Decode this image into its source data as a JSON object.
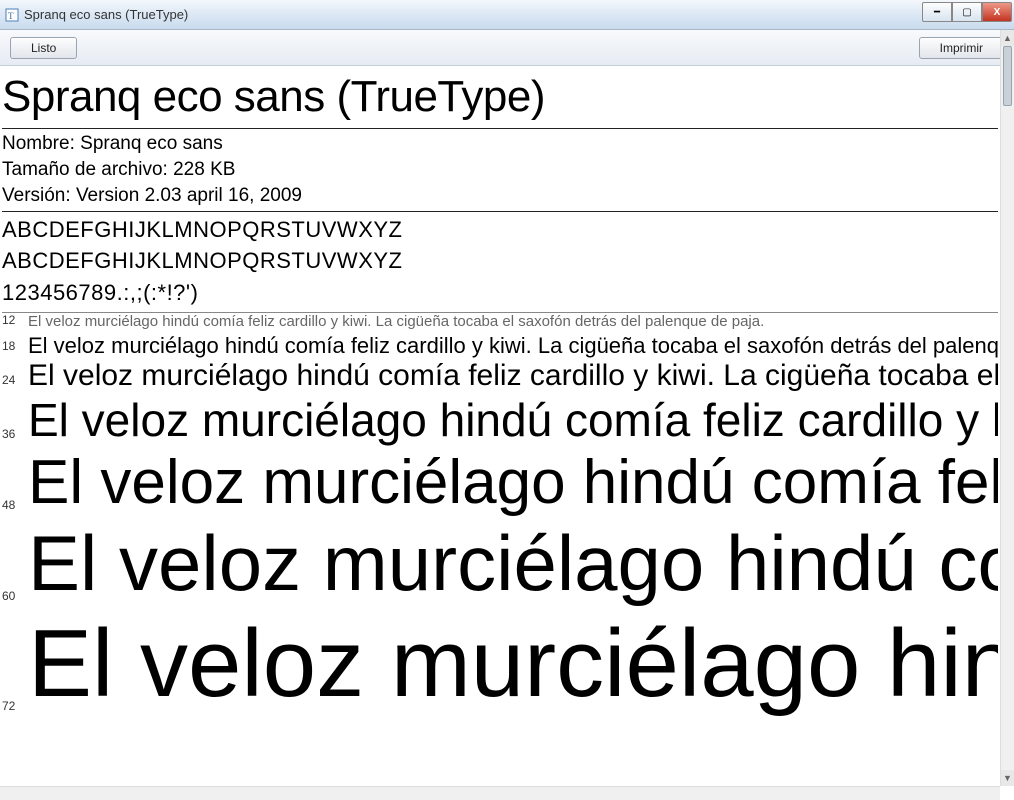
{
  "window": {
    "title": "Spranq eco sans (TrueType)"
  },
  "toolbar": {
    "done_label": "Listo",
    "print_label": "Imprimir"
  },
  "font": {
    "display_title": "Spranq eco sans (TrueType)",
    "name_label": "Nombre:",
    "name_value": "Spranq eco sans",
    "filesize_label": "Tamaño de archivo:",
    "filesize_value": "228 KB",
    "version_label": "Versión:",
    "version_value": "Version 2.03 april 16, 2009"
  },
  "charset": {
    "upper": "ABCDEFGHIJKLMNOPQRSTUVWXYZ",
    "lower": "ABCDEFGHIJKLMNOPQRSTUVWXYZ",
    "digits": "123456789.:,;(:*!?')"
  },
  "sample_sentence": "El veloz murciélago hindú comía feliz cardillo y kiwi. La cigüeña tocaba el saxofón detrás del palenque de paja.",
  "samples": {
    "s12": "12",
    "s18": "18",
    "s24": "24",
    "s36": "36",
    "s48": "48",
    "s60": "60",
    "s72": "72"
  }
}
